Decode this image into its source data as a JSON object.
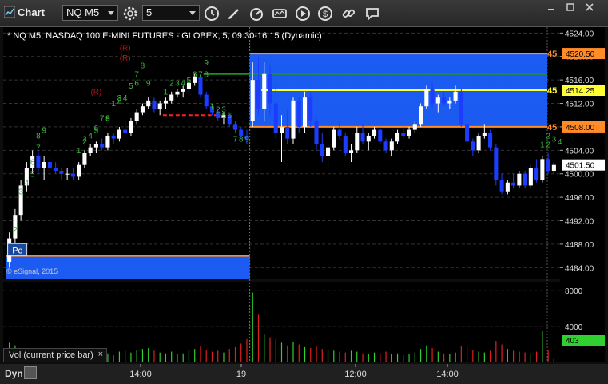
{
  "window": {
    "title": "Chart",
    "symbol": "NQ M5",
    "interval": "5"
  },
  "info_line": "* NQ M5, NASDAQ 100 E-MINI FUTURES - GLOBEX, 5, 09:30-16:15 (Dynamic)",
  "copyright": "© eSignal, 2015",
  "pc_label": "Pc",
  "volume_panel": {
    "label": "Vol (current price bar)",
    "close_symbol": "×",
    "current_value": "403"
  },
  "bottom": {
    "dyn_label": "Dyn"
  },
  "colors": {
    "up_bar": "#ffffff",
    "down_bar": "#1c3cff",
    "zone_blue": "#1e60ff",
    "orange_line": "#ff8c28",
    "yellow_line": "#ffff33",
    "green_line": "#1f8f1f",
    "td_count_green": "#3cb83c",
    "td_r_red": "#c01010",
    "vol_up": "#2fd02f",
    "vol_down": "#e02020"
  },
  "chart_data": {
    "type": "candlestick",
    "price_axis": {
      "ylim": [
        4482,
        4525
      ],
      "ticks": [
        4524.0,
        4520.0,
        4516.0,
        4512.0,
        4508.0,
        4504.0,
        4500.0,
        4496.0,
        4492.0,
        4488.0,
        4484.0
      ]
    },
    "volume_axis": {
      "ylim": [
        0,
        9000
      ],
      "ticks": [
        8000,
        4000
      ]
    },
    "x_tick_labels": [
      "14:00",
      "19",
      "12:00",
      "14:00"
    ],
    "price_tags": [
      {
        "label": "4520.50",
        "price": 4520.5,
        "style": "orange"
      },
      {
        "label": "4514.25",
        "price": 4514.25,
        "style": "yellow"
      },
      {
        "label": "4508.00",
        "price": 4508.0,
        "style": "orange"
      },
      {
        "label": "4501.50",
        "price": 4501.5,
        "style": "current"
      }
    ],
    "line_labels": [
      {
        "text": "45",
        "price": 4520.5,
        "style": "orange"
      },
      {
        "text": "45",
        "price": 4514.25,
        "style": "yellow"
      },
      {
        "text": "45",
        "price": 4508.0,
        "style": "orange"
      }
    ],
    "zones": [
      {
        "from_bar": 42,
        "to_bar": 95,
        "low": 4508.0,
        "high": 4520.5
      },
      {
        "from_bar": 0,
        "to_bar": 41,
        "low": 4482.0,
        "high": 4486.0
      }
    ],
    "horizontal_lines": [
      {
        "price": 4520.5,
        "from_bar": 42,
        "to_bar": 95,
        "style": "orange"
      },
      {
        "price": 4508.0,
        "from_bar": 42,
        "to_bar": 95,
        "style": "orange"
      },
      {
        "price": 4514.25,
        "from_bar": 44,
        "to_bar": 95,
        "style": "yellow"
      },
      {
        "price": 4517.0,
        "from_bar": 34,
        "to_bar": 95,
        "style": "green"
      },
      {
        "price": 4486.0,
        "from_bar": 0,
        "to_bar": 41,
        "style": "orange"
      },
      {
        "price": 4510.0,
        "from_bar": 27,
        "to_bar": 36,
        "style": "red-dashed"
      }
    ],
    "candles": [
      {
        "o": 4485.0,
        "h": 4490.0,
        "l": 4484.0,
        "c": 4489.0,
        "v": 2200
      },
      {
        "o": 4489.0,
        "h": 4494.0,
        "l": 4488.0,
        "c": 4493.0,
        "v": 1900
      },
      {
        "o": 4493.0,
        "h": 4499.0,
        "l": 4492.0,
        "c": 4498.0,
        "v": 1500
      },
      {
        "o": 4498.0,
        "h": 4502.0,
        "l": 4497.0,
        "c": 4501.0,
        "v": 1200
      },
      {
        "o": 4501.0,
        "h": 4504.0,
        "l": 4500.0,
        "c": 4503.0,
        "v": 1000
      },
      {
        "o": 4503.0,
        "h": 4504.0,
        "l": 4500.0,
        "c": 4501.0,
        "v": 1600
      },
      {
        "o": 4501.0,
        "h": 4503.0,
        "l": 4499.0,
        "c": 4502.0,
        "v": 900
      },
      {
        "o": 4502.0,
        "h": 4503.0,
        "l": 4500.0,
        "c": 4501.0,
        "v": 1100
      },
      {
        "o": 4501.0,
        "h": 4502.0,
        "l": 4500.0,
        "c": 4500.5,
        "v": 800
      },
      {
        "o": 4500.5,
        "h": 4501.0,
        "l": 4499.0,
        "c": 4500.0,
        "v": 700
      },
      {
        "o": 4500.0,
        "h": 4501.0,
        "l": 4499.0,
        "c": 4500.0,
        "v": 900
      },
      {
        "o": 4500.0,
        "h": 4501.0,
        "l": 4499.0,
        "c": 4499.5,
        "v": 1000
      },
      {
        "o": 4499.5,
        "h": 4502.0,
        "l": 4499.0,
        "c": 4501.5,
        "v": 1300
      },
      {
        "o": 4501.5,
        "h": 4504.0,
        "l": 4501.0,
        "c": 4503.5,
        "v": 1200
      },
      {
        "o": 4503.5,
        "h": 4505.0,
        "l": 4503.0,
        "c": 4504.5,
        "v": 1000
      },
      {
        "o": 4504.5,
        "h": 4505.5,
        "l": 4503.5,
        "c": 4505.0,
        "v": 900
      },
      {
        "o": 4505.0,
        "h": 4506.0,
        "l": 4504.0,
        "c": 4504.5,
        "v": 1100
      },
      {
        "o": 4504.5,
        "h": 4507.0,
        "l": 4504.0,
        "c": 4506.5,
        "v": 1000
      },
      {
        "o": 4506.5,
        "h": 4507.0,
        "l": 4505.0,
        "c": 4506.0,
        "v": 800
      },
      {
        "o": 4506.0,
        "h": 4508.0,
        "l": 4505.5,
        "c": 4507.5,
        "v": 1200
      },
      {
        "o": 4507.5,
        "h": 4509.0,
        "l": 4506.5,
        "c": 4507.0,
        "v": 1300
      },
      {
        "o": 4507.0,
        "h": 4509.5,
        "l": 4506.5,
        "c": 4509.0,
        "v": 1100
      },
      {
        "o": 4509.0,
        "h": 4511.0,
        "l": 4508.5,
        "c": 4510.5,
        "v": 1400
      },
      {
        "o": 4510.5,
        "h": 4512.0,
        "l": 4510.0,
        "c": 4511.5,
        "v": 1500
      },
      {
        "o": 4511.5,
        "h": 4513.0,
        "l": 4511.0,
        "c": 4512.5,
        "v": 1600
      },
      {
        "o": 4512.5,
        "h": 4513.0,
        "l": 4510.5,
        "c": 4511.0,
        "v": 1300
      },
      {
        "o": 4511.0,
        "h": 4512.5,
        "l": 4510.0,
        "c": 4512.0,
        "v": 1100
      },
      {
        "o": 4512.0,
        "h": 4513.0,
        "l": 4511.0,
        "c": 4512.5,
        "v": 1000
      },
      {
        "o": 4512.5,
        "h": 4514.0,
        "l": 4512.0,
        "c": 4513.5,
        "v": 1200
      },
      {
        "o": 4513.5,
        "h": 4514.5,
        "l": 4513.0,
        "c": 4514.0,
        "v": 900
      },
      {
        "o": 4514.0,
        "h": 4515.0,
        "l": 4513.0,
        "c": 4514.5,
        "v": 1000
      },
      {
        "o": 4514.5,
        "h": 4516.0,
        "l": 4514.0,
        "c": 4515.5,
        "v": 1400
      },
      {
        "o": 4515.5,
        "h": 4517.0,
        "l": 4515.0,
        "c": 4516.5,
        "v": 1500
      },
      {
        "o": 4516.5,
        "h": 4517.0,
        "l": 4513.0,
        "c": 4513.5,
        "v": 1800
      },
      {
        "o": 4513.5,
        "h": 4514.0,
        "l": 4511.0,
        "c": 4511.5,
        "v": 1400
      },
      {
        "o": 4511.5,
        "h": 4512.0,
        "l": 4510.0,
        "c": 4510.5,
        "v": 1200
      },
      {
        "o": 4510.5,
        "h": 4511.0,
        "l": 4509.0,
        "c": 4509.5,
        "v": 1300
      },
      {
        "o": 4509.5,
        "h": 4510.5,
        "l": 4508.5,
        "c": 4510.0,
        "v": 1100
      },
      {
        "o": 4510.0,
        "h": 4510.5,
        "l": 4508.0,
        "c": 4508.5,
        "v": 1500
      },
      {
        "o": 4508.5,
        "h": 4509.0,
        "l": 4507.0,
        "c": 4507.5,
        "v": 1700
      },
      {
        "o": 4507.5,
        "h": 4508.0,
        "l": 4506.0,
        "c": 4506.5,
        "v": 2100
      },
      {
        "o": 4506.5,
        "h": 4507.5,
        "l": 4505.0,
        "c": 4506.0,
        "v": 2600
      },
      {
        "o": 4509.0,
        "h": 4519.0,
        "l": 4508.0,
        "c": 4516.0,
        "v": 7800
      },
      {
        "o": 4516.0,
        "h": 4520.0,
        "l": 4510.0,
        "c": 4511.0,
        "v": 5400
      },
      {
        "o": 4511.0,
        "h": 4519.0,
        "l": 4509.0,
        "c": 4517.0,
        "v": 3200
      },
      {
        "o": 4517.0,
        "h": 4518.5,
        "l": 4510.0,
        "c": 4512.0,
        "v": 2800
      },
      {
        "o": 4512.0,
        "h": 4515.0,
        "l": 4506.0,
        "c": 4507.0,
        "v": 2600
      },
      {
        "o": 4507.0,
        "h": 4510.0,
        "l": 4502.0,
        "c": 4508.0,
        "v": 2200
      },
      {
        "o": 4508.0,
        "h": 4511.0,
        "l": 4505.0,
        "c": 4506.0,
        "v": 1900
      },
      {
        "o": 4506.0,
        "h": 4513.0,
        "l": 4505.0,
        "c": 4512.5,
        "v": 2300
      },
      {
        "o": 4512.5,
        "h": 4513.0,
        "l": 4507.0,
        "c": 4508.0,
        "v": 2000
      },
      {
        "o": 4508.0,
        "h": 4514.0,
        "l": 4507.0,
        "c": 4513.0,
        "v": 1700
      },
      {
        "o": 4513.0,
        "h": 4514.0,
        "l": 4508.0,
        "c": 4509.0,
        "v": 1600
      },
      {
        "o": 4509.0,
        "h": 4510.0,
        "l": 4504.0,
        "c": 4505.0,
        "v": 1800
      },
      {
        "o": 4505.0,
        "h": 4507.0,
        "l": 4502.0,
        "c": 4503.0,
        "v": 1500
      },
      {
        "o": 4503.0,
        "h": 4505.0,
        "l": 4501.0,
        "c": 4504.5,
        "v": 1400
      },
      {
        "o": 4504.5,
        "h": 4508.0,
        "l": 4504.0,
        "c": 4507.5,
        "v": 1300
      },
      {
        "o": 4507.5,
        "h": 4509.0,
        "l": 4506.0,
        "c": 4506.5,
        "v": 1200
      },
      {
        "o": 4506.5,
        "h": 4507.0,
        "l": 4503.0,
        "c": 4503.5,
        "v": 1100
      },
      {
        "o": 4503.5,
        "h": 4505.0,
        "l": 4502.0,
        "c": 4504.0,
        "v": 1300
      },
      {
        "o": 4504.0,
        "h": 4508.0,
        "l": 4503.5,
        "c": 4507.0,
        "v": 1200
      },
      {
        "o": 4507.0,
        "h": 4508.5,
        "l": 4505.0,
        "c": 4505.5,
        "v": 1000
      },
      {
        "o": 4505.5,
        "h": 4507.0,
        "l": 4504.0,
        "c": 4506.5,
        "v": 900
      },
      {
        "o": 4506.5,
        "h": 4508.0,
        "l": 4506.0,
        "c": 4507.5,
        "v": 1100
      },
      {
        "o": 4507.5,
        "h": 4508.0,
        "l": 4505.0,
        "c": 4505.5,
        "v": 1000
      },
      {
        "o": 4505.5,
        "h": 4506.0,
        "l": 4503.5,
        "c": 4504.0,
        "v": 1200
      },
      {
        "o": 4504.0,
        "h": 4506.0,
        "l": 4503.0,
        "c": 4505.5,
        "v": 900
      },
      {
        "o": 4505.5,
        "h": 4507.5,
        "l": 4505.0,
        "c": 4507.0,
        "v": 1000
      },
      {
        "o": 4507.0,
        "h": 4508.0,
        "l": 4506.0,
        "c": 4506.5,
        "v": 800
      },
      {
        "o": 4506.5,
        "h": 4508.0,
        "l": 4506.0,
        "c": 4507.5,
        "v": 900
      },
      {
        "o": 4507.5,
        "h": 4509.0,
        "l": 4507.0,
        "c": 4508.5,
        "v": 1100
      },
      {
        "o": 4508.5,
        "h": 4512.0,
        "l": 4508.0,
        "c": 4511.5,
        "v": 1500
      },
      {
        "o": 4511.5,
        "h": 4515.0,
        "l": 4511.0,
        "c": 4514.5,
        "v": 1900
      },
      {
        "o": 4514.5,
        "h": 4515.5,
        "l": 4511.0,
        "c": 4512.0,
        "v": 1600
      },
      {
        "o": 4512.0,
        "h": 4513.5,
        "l": 4510.5,
        "c": 4513.0,
        "v": 1200
      },
      {
        "o": 4513.0,
        "h": 4514.0,
        "l": 4511.5,
        "c": 4512.0,
        "v": 1000
      },
      {
        "o": 4512.0,
        "h": 4513.0,
        "l": 4511.0,
        "c": 4512.5,
        "v": 900
      },
      {
        "o": 4512.5,
        "h": 4515.0,
        "l": 4512.0,
        "c": 4514.0,
        "v": 1100
      },
      {
        "o": 4514.0,
        "h": 4514.5,
        "l": 4508.0,
        "c": 4508.5,
        "v": 1800
      },
      {
        "o": 4508.5,
        "h": 4509.0,
        "l": 4505.0,
        "c": 4505.5,
        "v": 1700
      },
      {
        "o": 4505.5,
        "h": 4506.0,
        "l": 4503.0,
        "c": 4504.0,
        "v": 1400
      },
      {
        "o": 4504.0,
        "h": 4507.0,
        "l": 4503.5,
        "c": 4506.5,
        "v": 1200
      },
      {
        "o": 4506.5,
        "h": 4508.5,
        "l": 4506.0,
        "c": 4507.0,
        "v": 1100
      },
      {
        "o": 4507.0,
        "h": 4507.5,
        "l": 4504.0,
        "c": 4504.5,
        "v": 1300
      },
      {
        "o": 4504.5,
        "h": 4505.0,
        "l": 4498.0,
        "c": 4499.0,
        "v": 2400
      },
      {
        "o": 4499.0,
        "h": 4500.0,
        "l": 4496.5,
        "c": 4497.0,
        "v": 2000
      },
      {
        "o": 4497.0,
        "h": 4499.0,
        "l": 4496.5,
        "c": 4498.5,
        "v": 1500
      },
      {
        "o": 4498.5,
        "h": 4500.0,
        "l": 4497.5,
        "c": 4498.0,
        "v": 1300
      },
      {
        "o": 4498.0,
        "h": 4500.5,
        "l": 4497.5,
        "c": 4500.0,
        "v": 1200
      },
      {
        "o": 4500.0,
        "h": 4500.5,
        "l": 4497.5,
        "c": 4498.0,
        "v": 1100
      },
      {
        "o": 4498.0,
        "h": 4501.5,
        "l": 4497.5,
        "c": 4501.0,
        "v": 1000
      },
      {
        "o": 4501.0,
        "h": 4502.5,
        "l": 4498.5,
        "c": 4499.0,
        "v": 1200
      },
      {
        "o": 4499.0,
        "h": 4503.0,
        "l": 4498.5,
        "c": 4502.5,
        "v": 3500
      },
      {
        "o": 4502.5,
        "h": 4503.5,
        "l": 4500.0,
        "c": 4500.5,
        "v": 1400
      },
      {
        "o": 4500.5,
        "h": 4502.0,
        "l": 4500.0,
        "c": 4501.5,
        "v": 403
      }
    ],
    "annotations": [
      {
        "text": "(R)",
        "bar": 20,
        "price": 4521.0,
        "color": "red"
      },
      {
        "text": "(R)",
        "bar": 20,
        "price": 4519.3,
        "color": "red"
      },
      {
        "text": "(R)",
        "bar": 15,
        "price": 4513.5,
        "color": "red"
      },
      {
        "text": "2",
        "bar": 1,
        "price": 4490.0,
        "color": "green"
      },
      {
        "text": "3",
        "bar": 2,
        "price": 4496.5,
        "color": "green"
      },
      {
        "text": "4",
        "bar": 3,
        "price": 4498.0,
        "color": "green"
      },
      {
        "text": "5",
        "bar": 4,
        "price": 4499.5,
        "color": "green"
      },
      {
        "text": "6",
        "bar": 4,
        "price": 4501.5,
        "color": "green"
      },
      {
        "text": "7",
        "bar": 5,
        "price": 4504.0,
        "color": "green"
      },
      {
        "text": "8",
        "bar": 5,
        "price": 4506.0,
        "color": "green"
      },
      {
        "text": "9",
        "bar": 6,
        "price": 4507.0,
        "color": "green"
      },
      {
        "text": "1",
        "bar": 12,
        "price": 4503.5,
        "color": "green"
      },
      {
        "text": "2",
        "bar": 13,
        "price": 4505.0,
        "color": "green"
      },
      {
        "text": "3",
        "bar": 13,
        "price": 4505.5,
        "color": "green"
      },
      {
        "text": "4",
        "bar": 14,
        "price": 4506.0,
        "color": "green"
      },
      {
        "text": "5",
        "bar": 15,
        "price": 4507.0,
        "color": "green"
      },
      {
        "text": "6",
        "bar": 15,
        "price": 4507.3,
        "color": "green"
      },
      {
        "text": "7",
        "bar": 16,
        "price": 4509.0,
        "color": "green"
      },
      {
        "text": "8",
        "bar": 17,
        "price": 4509.0,
        "color": "green"
      },
      {
        "text": "9",
        "bar": 17,
        "price": 4509.0,
        "color": "green"
      },
      {
        "text": "1",
        "bar": 18,
        "price": 4511.5,
        "color": "green"
      },
      {
        "text": "2",
        "bar": 19,
        "price": 4512.0,
        "color": "green"
      },
      {
        "text": "3",
        "bar": 19,
        "price": 4512.5,
        "color": "green"
      },
      {
        "text": "4",
        "bar": 20,
        "price": 4512.5,
        "color": "green"
      },
      {
        "text": "5",
        "bar": 21,
        "price": 4514.5,
        "color": "green"
      },
      {
        "text": "6",
        "bar": 22,
        "price": 4515.0,
        "color": "green"
      },
      {
        "text": "7",
        "bar": 22,
        "price": 4516.5,
        "color": "green"
      },
      {
        "text": "8",
        "bar": 23,
        "price": 4518.0,
        "color": "green"
      },
      {
        "text": "9",
        "bar": 24,
        "price": 4515.0,
        "color": "green"
      },
      {
        "text": "1",
        "bar": 27,
        "price": 4513.5,
        "color": "green"
      },
      {
        "text": "2",
        "bar": 28,
        "price": 4515.0,
        "color": "green"
      },
      {
        "text": "3",
        "bar": 29,
        "price": 4515.0,
        "color": "green"
      },
      {
        "text": "4",
        "bar": 30,
        "price": 4515.0,
        "color": "green"
      },
      {
        "text": "5",
        "bar": 31,
        "price": 4515.5,
        "color": "green"
      },
      {
        "text": "6",
        "bar": 32,
        "price": 4516.5,
        "color": "green"
      },
      {
        "text": "7",
        "bar": 33,
        "price": 4516.5,
        "color": "green"
      },
      {
        "text": "8",
        "bar": 34,
        "price": 4516.5,
        "color": "green"
      },
      {
        "text": "9",
        "bar": 34,
        "price": 4518.5,
        "color": "green"
      },
      {
        "text": "1",
        "bar": 35,
        "price": 4511.0,
        "color": "green"
      },
      {
        "text": "2",
        "bar": 36,
        "price": 4510.5,
        "color": "green"
      },
      {
        "text": "3",
        "bar": 37,
        "price": 4510.5,
        "color": "green"
      },
      {
        "text": "5",
        "bar": 37,
        "price": 4509.5,
        "color": "green"
      },
      {
        "text": "6",
        "bar": 38,
        "price": 4509.5,
        "color": "green"
      },
      {
        "text": "7",
        "bar": 39,
        "price": 4505.5,
        "color": "green"
      },
      {
        "text": "8",
        "bar": 40,
        "price": 4505.5,
        "color": "green"
      },
      {
        "text": "9",
        "bar": 41,
        "price": 4505.5,
        "color": "green"
      },
      {
        "text": "2",
        "bar": 93,
        "price": 4506.0,
        "color": "green"
      },
      {
        "text": "3",
        "bar": 94,
        "price": 4505.5,
        "color": "green"
      },
      {
        "text": "4",
        "bar": 95,
        "price": 4505.0,
        "color": "green"
      },
      {
        "text": "1",
        "bar": 92,
        "price": 4504.5,
        "color": "green"
      },
      {
        "text": "2",
        "bar": 93,
        "price": 4504.5,
        "color": "green"
      }
    ],
    "pc_marker": {
      "bar": 0,
      "price": 4487.0
    }
  }
}
